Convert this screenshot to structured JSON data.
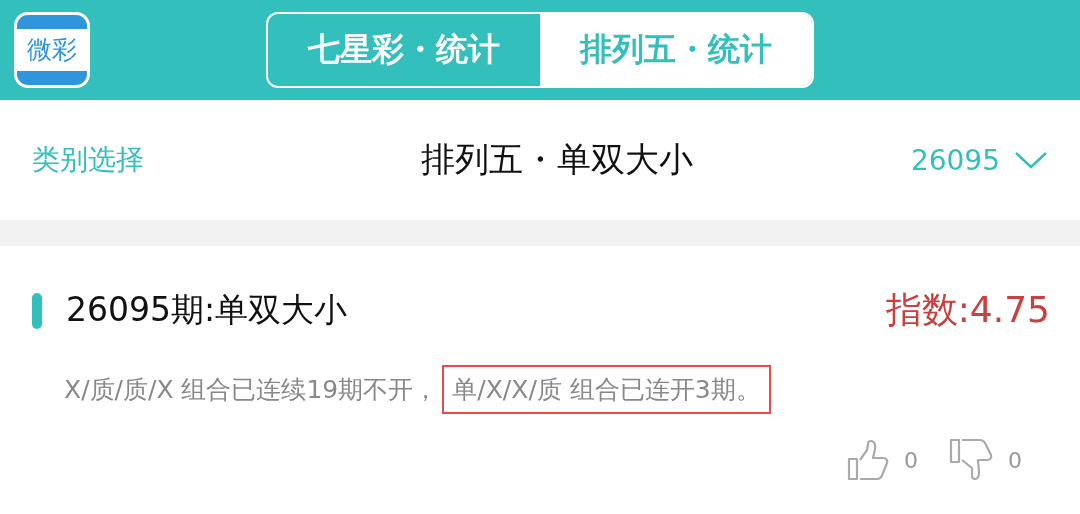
{
  "app_logo": {
    "text": "微彩"
  },
  "tabs": [
    {
      "label": "七星彩・统计",
      "selected": false
    },
    {
      "label": "排列五・统计",
      "selected": true
    }
  ],
  "nav": {
    "category_link": "类别选择",
    "title": "排列五・单双大小",
    "period": "26095"
  },
  "item": {
    "title": "26095期:单双大小",
    "index": "指数:4.75",
    "description": [
      {
        "text": "X/质/质/X 组合已连续19期不开，",
        "highlighted": false
      },
      {
        "text": "单/X/X/质 组合已连开3期。",
        "highlighted": true
      }
    ],
    "likes": "0",
    "dislikes": "0"
  }
}
